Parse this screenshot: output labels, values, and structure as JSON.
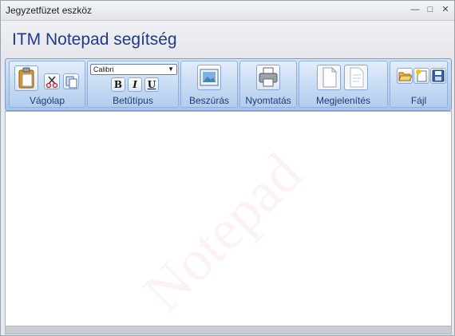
{
  "window": {
    "title": "Jegyzetfüzet eszköz",
    "controls": {
      "minimize": "—",
      "maximize": "□",
      "close": "✕"
    }
  },
  "header": {
    "app_title": "ITM Notepad segítség"
  },
  "ribbon": {
    "groups": [
      {
        "label": "Vágólap"
      },
      {
        "label": "Betűtípus"
      },
      {
        "label": "Beszúrás"
      },
      {
        "label": "Nyomtatás"
      },
      {
        "label": "Megjelenítés"
      },
      {
        "label": "Fájl"
      }
    ],
    "font": {
      "selected": "Calibri"
    },
    "format_buttons": {
      "bold": "B",
      "italic": "I",
      "underline": "U"
    }
  },
  "editor": {
    "watermark": "Notepad",
    "content": ""
  },
  "colors": {
    "title": "#1f3a8a",
    "ribbon": "#b8d0ef"
  }
}
